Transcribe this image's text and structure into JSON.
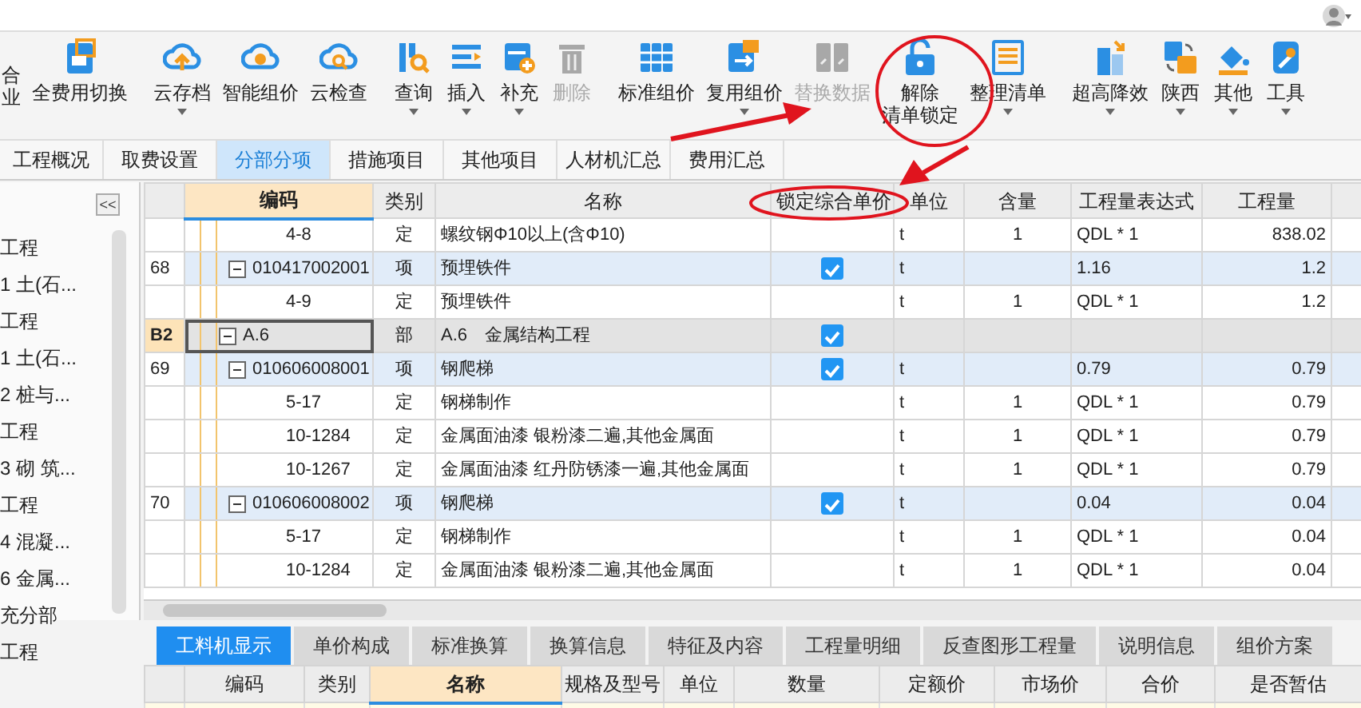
{
  "toolbar": [
    [
      {
        "lines": [
          "合",
          "业"
        ],
        "dropdown": false,
        "disabled": false
      },
      {
        "lines": [
          "全费用切换"
        ],
        "dropdown": false,
        "disabled": false
      }
    ],
    [
      {
        "lines": [
          "云存档"
        ],
        "dropdown": true,
        "disabled": false
      },
      {
        "lines": [
          "智能组价"
        ],
        "dropdown": false,
        "disabled": false
      },
      {
        "lines": [
          "云检查"
        ],
        "dropdown": false,
        "disabled": false
      }
    ],
    [
      {
        "lines": [
          "查询"
        ],
        "dropdown": true,
        "disabled": false
      },
      {
        "lines": [
          "插入"
        ],
        "dropdown": true,
        "disabled": false
      },
      {
        "lines": [
          "补充"
        ],
        "dropdown": true,
        "disabled": false
      },
      {
        "lines": [
          "删除"
        ],
        "dropdown": false,
        "disabled": true
      }
    ],
    [
      {
        "lines": [
          "标准组价"
        ],
        "dropdown": false,
        "disabled": false
      },
      {
        "lines": [
          "复用组价"
        ],
        "dropdown": true,
        "disabled": false
      },
      {
        "lines": [
          "替换数据"
        ],
        "dropdown": false,
        "disabled": true
      },
      {
        "lines": [
          "解除",
          "清单锁定"
        ],
        "dropdown": false,
        "disabled": false
      },
      {
        "lines": [
          "整理清单"
        ],
        "dropdown": true,
        "disabled": false
      }
    ],
    [
      {
        "lines": [
          "超高降效"
        ],
        "dropdown": true,
        "disabled": false
      },
      {
        "lines": [
          "陕西"
        ],
        "dropdown": true,
        "disabled": false
      },
      {
        "lines": [
          "其他"
        ],
        "dropdown": true,
        "disabled": false
      },
      {
        "lines": [
          "工具"
        ],
        "dropdown": true,
        "disabled": false
      }
    ]
  ],
  "tabs": [
    {
      "label": "工程概况",
      "selected": false
    },
    {
      "label": "取费设置",
      "selected": false
    },
    {
      "label": "分部分项",
      "selected": true
    },
    {
      "label": "措施项目",
      "selected": false
    },
    {
      "label": "其他项目",
      "selected": false
    },
    {
      "label": "人材机汇总",
      "selected": false
    },
    {
      "label": "费用汇总",
      "selected": false
    }
  ],
  "sidebar": {
    "collapse": "<<",
    "items": [
      "工程",
      "1 土(石...",
      "工程",
      "1 土(石...",
      "2 桩与...",
      "工程",
      "3 砌 筑...",
      "工程",
      "4 混凝...",
      "6 金属...",
      "充分部",
      "工程"
    ]
  },
  "grid": {
    "columns": [
      "",
      "编码",
      "类别",
      "名称",
      "锁定综合单价",
      "单位",
      "含量",
      "工程量表达式",
      "工程量"
    ],
    "rows": [
      {
        "kind": "quota",
        "code": "4-8",
        "type": "定",
        "name": "螺纹钢Φ10以上(含Φ10)",
        "unit": "t",
        "ratio": "1",
        "expr": "QDL * 1",
        "qty": "838.02",
        "selected": false
      },
      {
        "kind": "item",
        "no": "68",
        "code": "010417002001",
        "type": "项",
        "name": "预埋铁件",
        "locked": true,
        "unit": "t",
        "expr": "1.16",
        "qty": "1.2",
        "selected": false,
        "expanded": true,
        "children": [
          {
            "kind": "quota",
            "code": "4-9",
            "type": "定",
            "name": "预埋铁件",
            "unit": "t",
            "ratio": "1",
            "expr": "QDL * 1",
            "qty": "1.2",
            "selected": false
          }
        ]
      },
      {
        "kind": "section",
        "no": "B2",
        "code": "A.6",
        "type": "部",
        "name": "A.6　金属结构工程",
        "locked": true,
        "selected": true,
        "expanded": true,
        "children": [
          {
            "kind": "item",
            "no": "69",
            "code": "010606008001",
            "type": "项",
            "name": "钢爬梯",
            "locked": true,
            "unit": "t",
            "expr": "0.79",
            "qty": "0.79",
            "selected": false,
            "expanded": true,
            "children": [
              {
                "kind": "quota",
                "code": "5-17",
                "type": "定",
                "name": "钢梯制作",
                "unit": "t",
                "ratio": "1",
                "expr": "QDL * 1",
                "qty": "0.79",
                "selected": false
              },
              {
                "kind": "quota",
                "code": "10-1284",
                "type": "定",
                "name": "金属面油漆 银粉漆二遍,其他金属面",
                "unit": "t",
                "ratio": "1",
                "expr": "QDL * 1",
                "qty": "0.79",
                "selected": false
              },
              {
                "kind": "quota",
                "code": "10-1267",
                "type": "定",
                "name": "金属面油漆 红丹防锈漆一遍,其他金属面",
                "unit": "t",
                "ratio": "1",
                "expr": "QDL * 1",
                "qty": "0.79",
                "selected": false
              }
            ]
          },
          {
            "kind": "item",
            "no": "70",
            "code": "010606008002",
            "type": "项",
            "name": "钢爬梯",
            "locked": true,
            "unit": "t",
            "expr": "0.04",
            "qty": "0.04",
            "selected": false,
            "expanded": true,
            "children": [
              {
                "kind": "quota",
                "code": "5-17",
                "type": "定",
                "name": "钢梯制作",
                "unit": "t",
                "ratio": "1",
                "expr": "QDL * 1",
                "qty": "0.04",
                "selected": false
              },
              {
                "kind": "quota",
                "code": "10-1284",
                "type": "定",
                "name": "金属面油漆 银粉漆二遍,其他金属面",
                "unit": "t",
                "ratio": "1",
                "expr": "QDL * 1",
                "qty": "0.04",
                "selected": false
              }
            ]
          }
        ]
      }
    ]
  },
  "bottom_tabs": [
    {
      "label": "工料机显示",
      "selected": true
    },
    {
      "label": "单价构成",
      "selected": false
    },
    {
      "label": "标准换算",
      "selected": false
    },
    {
      "label": "换算信息",
      "selected": false
    },
    {
      "label": "特征及内容",
      "selected": false
    },
    {
      "label": "工程量明细",
      "selected": false
    },
    {
      "label": "反查图形工程量",
      "selected": false
    },
    {
      "label": "说明信息",
      "selected": false
    },
    {
      "label": "组价方案",
      "selected": false
    }
  ],
  "bottom_columns": [
    {
      "selected": false
    },
    {
      "label": "编码",
      "selected": false
    },
    {
      "label": "类别",
      "selected": false
    },
    {
      "label": "名称",
      "selected": true
    },
    {
      "label": "规格及型号",
      "selected": false
    },
    {
      "label": "单位",
      "selected": false
    },
    {
      "label": "数量",
      "selected": false
    },
    {
      "label": "定额价",
      "selected": false
    },
    {
      "label": "市场价",
      "selected": false
    },
    {
      "label": "合价",
      "selected": false
    },
    {
      "label": "是否暂估",
      "selected": false
    }
  ]
}
